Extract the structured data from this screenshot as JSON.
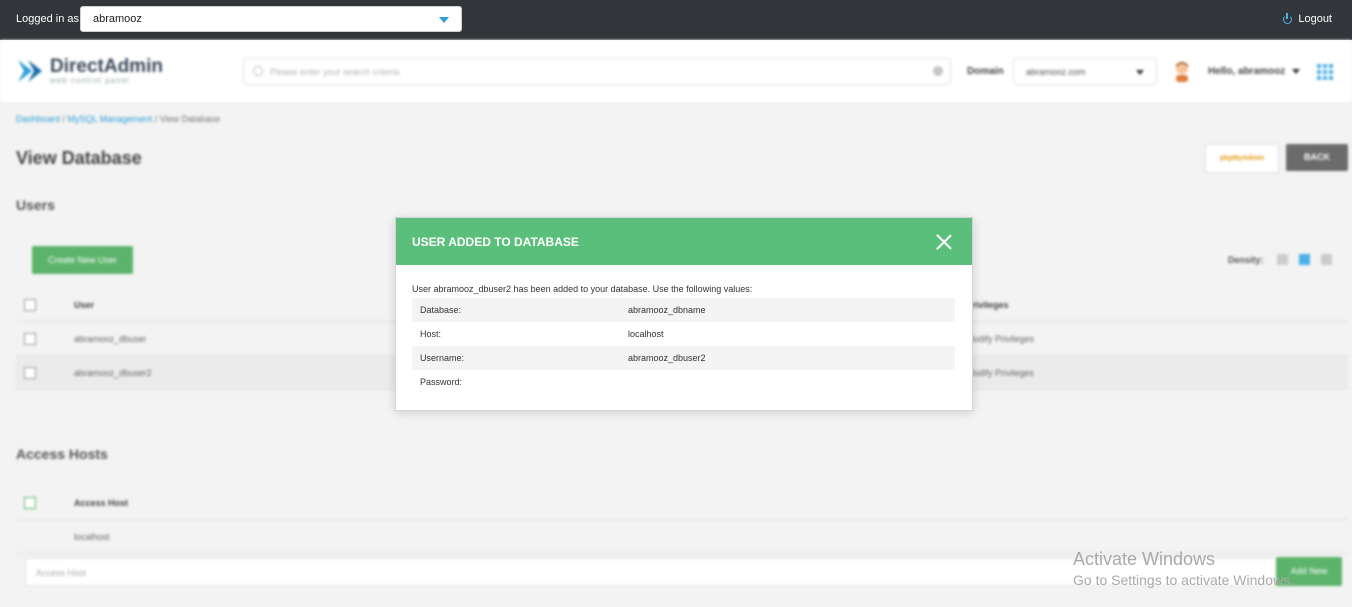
{
  "topbar": {
    "logged_in_label": "Logged in as",
    "user_value": "abramooz",
    "logout_label": "Logout"
  },
  "header": {
    "logo_name": "DirectAdmin",
    "logo_sub": "web control panel",
    "search_placeholder": "Please enter your search criteria",
    "domain_label": "Domain",
    "domain_value": "abramooz.com",
    "hello": "Hello, abramooz"
  },
  "breadcrumb": {
    "dashboard": "Dashboard",
    "mysql": "MySQL Management",
    "current": "View Database"
  },
  "page": {
    "title": "View Database",
    "phpmyadmin": "phpMyAdmin",
    "back": "BACK",
    "users_title": "Users",
    "create_user": "Create New User",
    "density_label": "Density:",
    "users_headers": [
      "User",
      "Privileges"
    ],
    "users_rows": [
      {
        "user": "abramooz_dbuser",
        "priv": "Modify Privileges"
      },
      {
        "user": "abramooz_dbuser2",
        "priv": "Modify Privileges"
      }
    ],
    "access_title": "Access Hosts",
    "access_header": "Access Host",
    "access_rows": [
      "localhost"
    ],
    "access_placeholder": "Access Host",
    "add_new": "Add New"
  },
  "modal": {
    "title": "USER ADDED TO DATABASE",
    "message": "User abramooz_dbuser2 has been added to your database. Use the following values:",
    "rows": [
      {
        "key": "Database:",
        "value": "abramooz_dbname"
      },
      {
        "key": "Host:",
        "value": "localhost"
      },
      {
        "key": "Username:",
        "value": "abramooz_dbuser2"
      },
      {
        "key": "Password:",
        "value": ""
      }
    ]
  },
  "watermark": {
    "line1": "Activate Windows",
    "line2": "Go to Settings to activate Windows."
  },
  "colors": {
    "topbar": "#323539",
    "accent": "#2b9fd8",
    "modal_header": "#5bbf7c",
    "green_button": "#5cb36b"
  },
  "icons": [
    "power-icon",
    "search-icon",
    "clear-icon",
    "avatar-icon",
    "apps-grid-icon",
    "close-icon",
    "caret-down-icon"
  ]
}
